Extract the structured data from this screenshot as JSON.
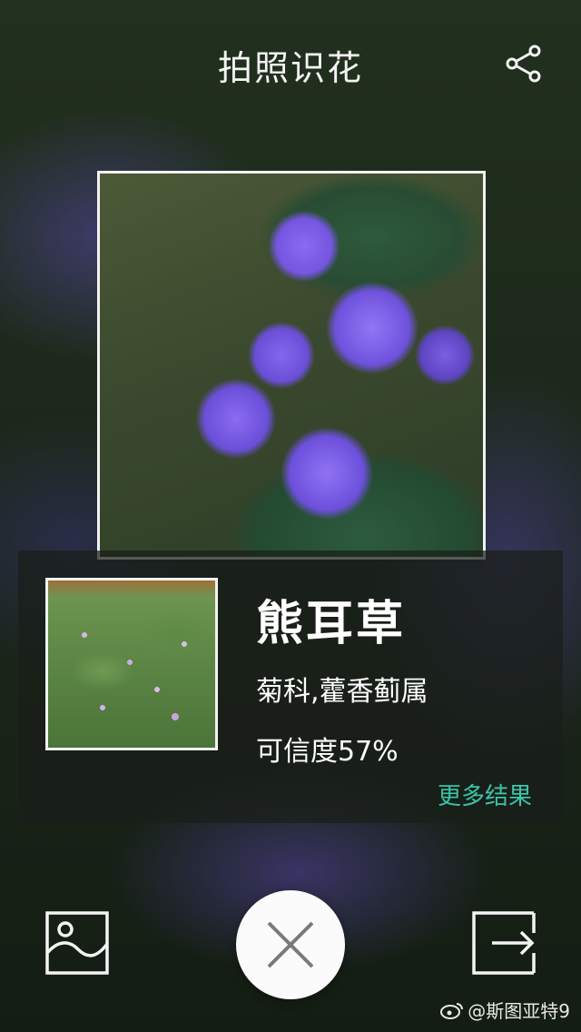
{
  "header": {
    "title": "拍照识花"
  },
  "result": {
    "name": "熊耳草",
    "family": "菊科,藿香蓟属",
    "confidence": "可信度57%",
    "more": "更多结果"
  },
  "icons": {
    "share": "share-icon",
    "gallery": "image-gallery-icon",
    "close": "close-icon",
    "exit": "exit-icon",
    "watermark_logo": "weibo-logo"
  },
  "watermark": {
    "text": "@斯图亚特9"
  },
  "colors": {
    "accent": "#3cc3a7",
    "frame": "#f2f2f2"
  }
}
